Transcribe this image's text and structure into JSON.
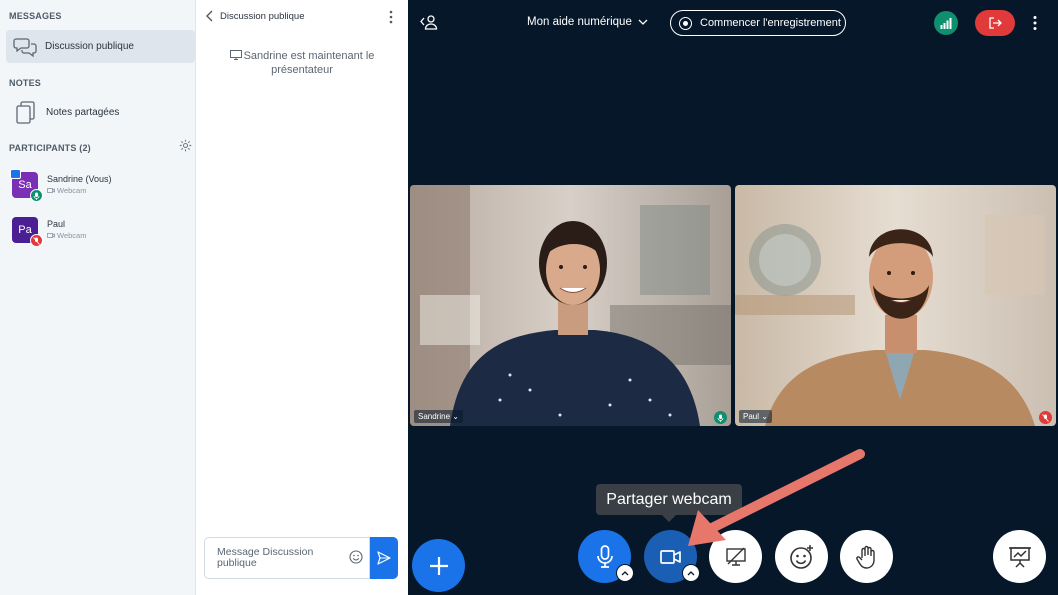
{
  "sidebar": {
    "messages_title": "MESSAGES",
    "public_chat_label": "Discussion publique",
    "notes_title": "NOTES",
    "shared_notes_label": "Notes partagées",
    "participants_title": "PARTICIPANTS (2)",
    "participants": [
      {
        "initials": "Sa",
        "name": "Sandrine (Vous)",
        "status": "Webcam",
        "avatar_color": "#7b2fb5",
        "mic": "on"
      },
      {
        "initials": "Pa",
        "name": "Paul",
        "status": "Webcam",
        "avatar_color": "#4b1f94",
        "mic": "muted"
      }
    ]
  },
  "chat": {
    "title": "Discussion publique",
    "system_message": "Sandrine est maintenant le présentateur",
    "input_placeholder": "Message Discussion publique"
  },
  "header": {
    "room_title": "Mon aide numérique",
    "record_label": "Commencer l'enregistrement"
  },
  "videos": [
    {
      "name": "Sandrine",
      "mic": "on"
    },
    {
      "name": "Paul",
      "mic": "muted"
    }
  ],
  "toolbar": {
    "tooltip": "Partager webcam",
    "buttons": [
      "plus-icon",
      "microphone-icon",
      "camera-icon",
      "screen-share-icon",
      "emoji-icon",
      "hand-icon",
      "presentation-icon"
    ]
  },
  "colors": {
    "primary": "#1a73e8",
    "background": "#06172a",
    "danger": "#e13a3a",
    "success": "#0e8f6e",
    "annotation_arrow": "#e8776b"
  }
}
